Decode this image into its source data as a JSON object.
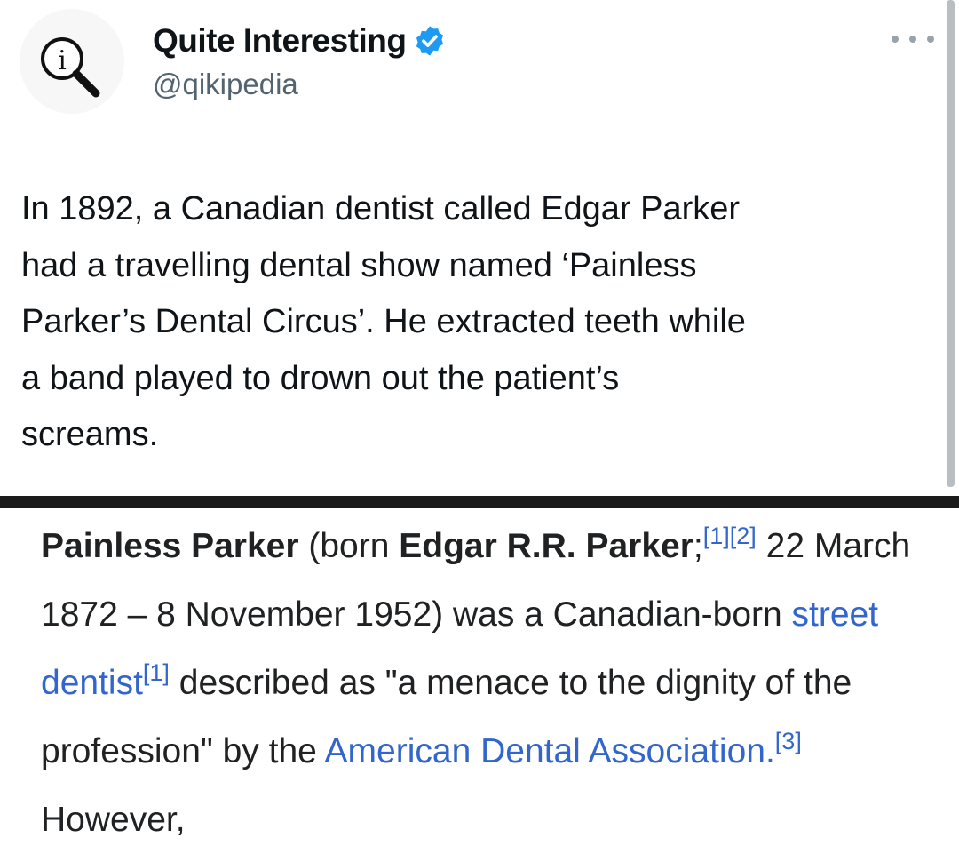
{
  "tweet": {
    "display_name": "Quite Interesting",
    "handle": "@qikipedia",
    "text": "In 1892, a Canadian dentist called Edgar Parker\nhad a travelling dental show named ‘Painless\nParker’s Dental Circus’. He extracted teeth while\na band played to drown out the patient’s\nscreams."
  },
  "wiki": {
    "subject_bold": "Painless Parker",
    "born_prefix": " (born ",
    "born_name": "Edgar R.R. Parker",
    "semicolon": ";",
    "cite_1": "[1]",
    "cite_2": "[2]",
    "dates_text": " 22 March 1872 – 8 November 1952) was a Canadian-born ",
    "link_street_dentist": "street dentist",
    "cite_1b": "[1]",
    "described_text": " described as \"a menace to the dignity of the profession\" by the ",
    "link_ada": "American Dental Association.",
    "cite_3": "[3]",
    "however_text": " However,"
  },
  "colors": {
    "verified_blue": "#1d9bf0",
    "wiki_link": "#3366cc",
    "handle_gray": "#536471"
  },
  "icons": [
    "info-magnifier-icon",
    "verified-badge-icon",
    "more-options-icon"
  ]
}
